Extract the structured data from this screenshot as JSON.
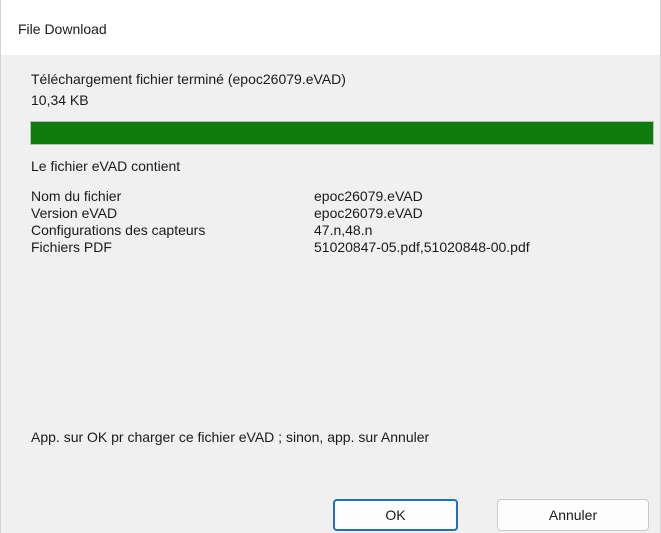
{
  "window": {
    "title": "File Download"
  },
  "download": {
    "status": "Téléchargement fichier terminé (epoc26079.eVAD)",
    "size": "10,34 KB",
    "progress_fraction": 1.0
  },
  "contents": {
    "heading": "Le fichier eVAD contient",
    "rows": [
      {
        "label": "Nom du fichier",
        "value": "epoc26079.eVAD"
      },
      {
        "label": "Version eVAD",
        "value": "epoc26079.eVAD"
      },
      {
        "label": "Configurations des capteurs",
        "value": "47.n,48.n"
      },
      {
        "label": "Fichiers PDF",
        "value": "51020847-05.pdf,51020848-00.pdf"
      }
    ]
  },
  "prompt": "App. sur OK pr charger ce fichier eVAD ; sinon, app. sur Annuler",
  "buttons": {
    "ok": "OK",
    "cancel": "Annuler"
  },
  "colors": {
    "progress_fill": "#0f7b0f",
    "focus_border": "#1d6fc4"
  }
}
